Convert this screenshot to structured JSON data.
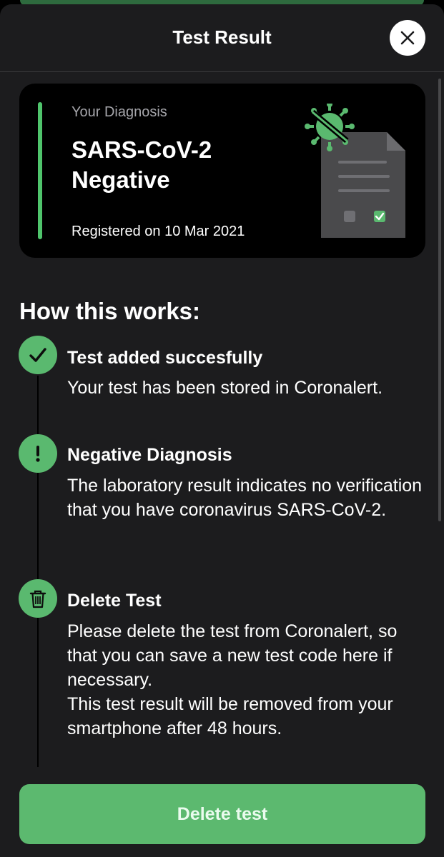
{
  "header": {
    "title": "Test Result",
    "close_icon": "close-icon"
  },
  "diagnosis_card": {
    "label": "Your Diagnosis",
    "result": "SARS-CoV-2 Negative",
    "registered": "Registered on 10 Mar 2021",
    "illustration": "test-document-virus-icon",
    "accent_color": "#4fc46c"
  },
  "how_it_works": {
    "heading": "How this works:",
    "steps": [
      {
        "icon": "checkmark-icon",
        "title": "Test added succesfully",
        "description": "Your test has been stored in Coronalert."
      },
      {
        "icon": "exclamation-icon",
        "title": "Negative Diagnosis",
        "description": "The laboratory result indicates no verification that you have coronavirus SARS-CoV-2."
      },
      {
        "icon": "trash-icon",
        "title": "Delete Test",
        "description": "Please delete the test from Coronalert, so that you can save a new test code here if necessary.\nThis test result will be removed from your smartphone after 48 hours."
      }
    ]
  },
  "footer": {
    "delete_button": "Delete test"
  },
  "colors": {
    "background": "#1c1c1e",
    "accent_green": "#5cb96f",
    "card_background": "#000000"
  }
}
